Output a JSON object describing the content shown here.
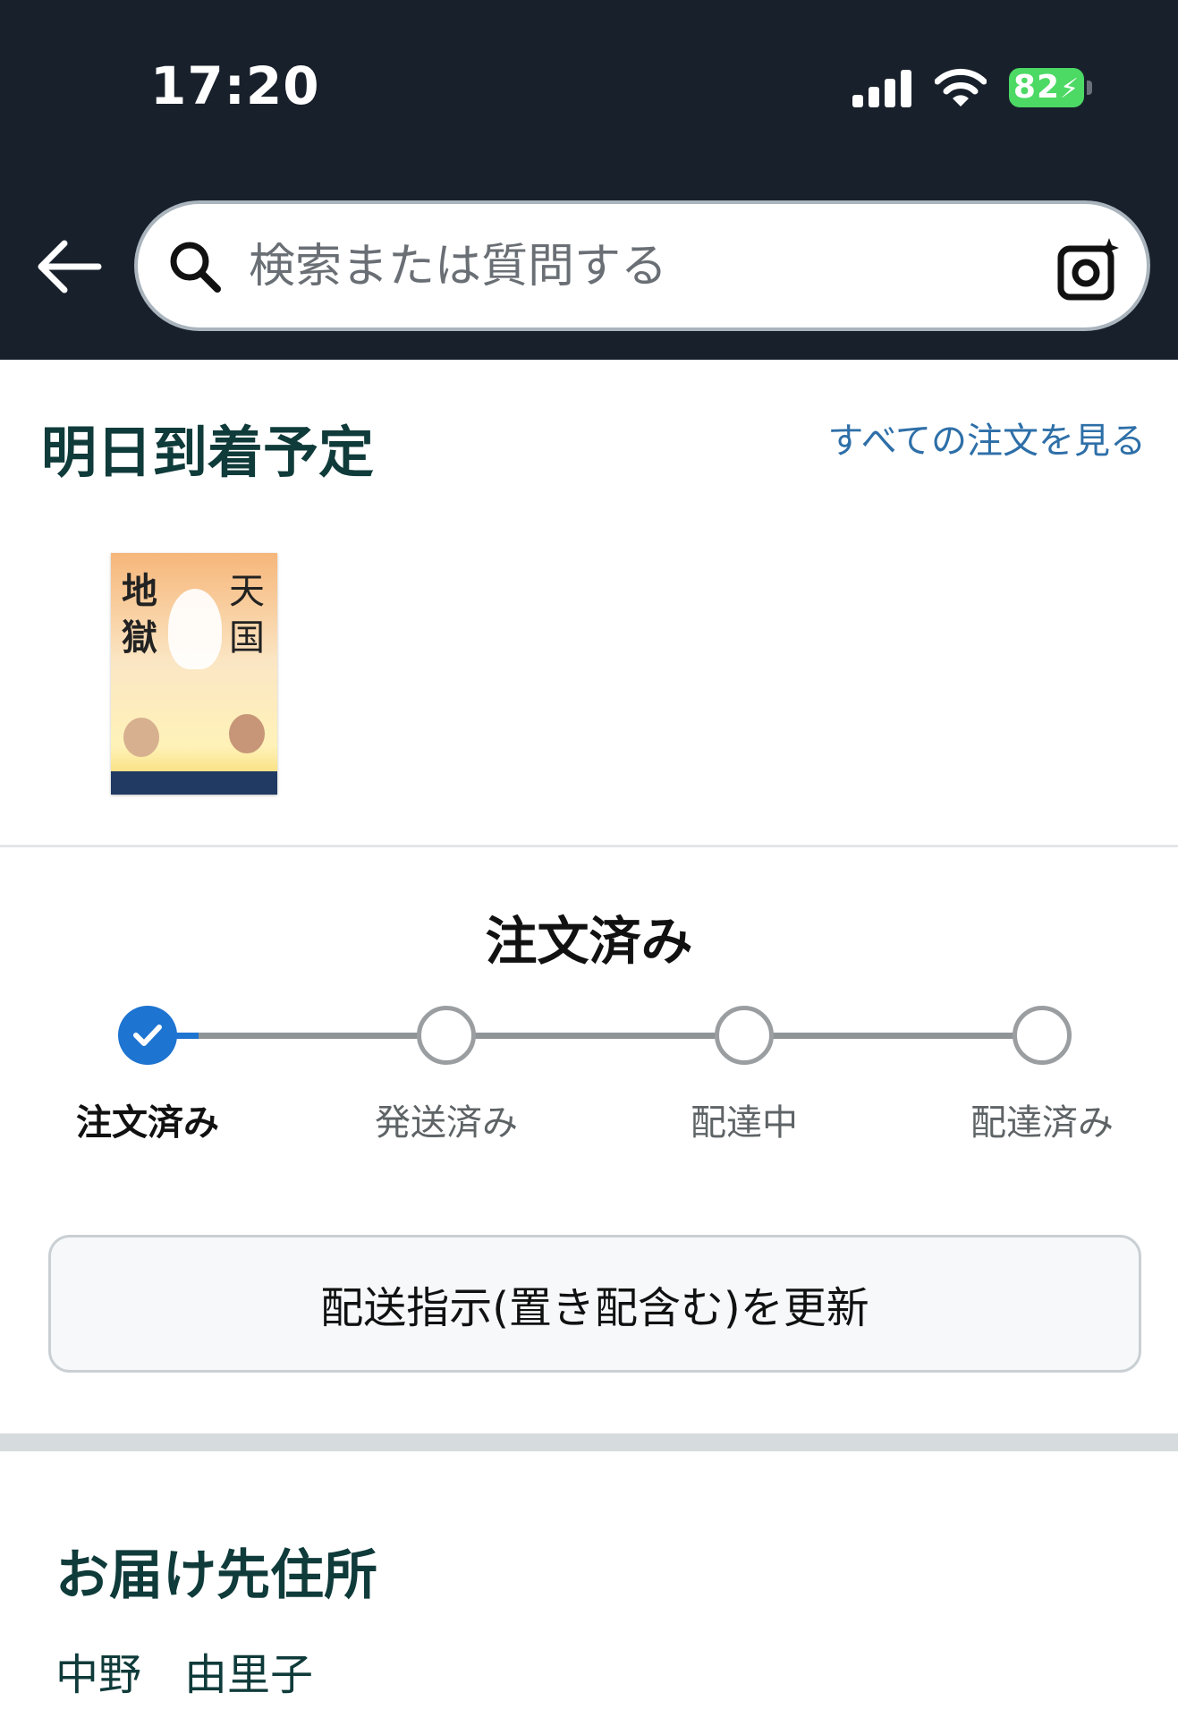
{
  "status_bar": {
    "time": "17:20",
    "battery": "82",
    "icons": [
      "cellular-signal-icon",
      "wifi-icon",
      "battery-charging-icon"
    ]
  },
  "header": {
    "back_icon": "arrow-left-icon",
    "search": {
      "placeholder": "検索または質問する",
      "value": "",
      "icon": "search-icon",
      "camera_icon": "camera-lens-icon"
    },
    "background_color": "#18202b"
  },
  "arrival": {
    "title": "明日到着予定",
    "all_orders_link": "すべての注文を見る",
    "book_cover_text": [
      "地",
      "獄",
      "天",
      "国"
    ]
  },
  "progress": {
    "current_status": "注文済み",
    "steps": [
      {
        "label": "注文済み",
        "state": "done"
      },
      {
        "label": "発送済み",
        "state": "pending"
      },
      {
        "label": "配達中",
        "state": "pending"
      },
      {
        "label": "配達済み",
        "state": "pending"
      }
    ],
    "accent_color": "#1e74d1"
  },
  "update_button": {
    "label": "配送指示(置き配含む)を更新"
  },
  "address": {
    "title": "お届け先住所",
    "name": "中野　由里子"
  }
}
